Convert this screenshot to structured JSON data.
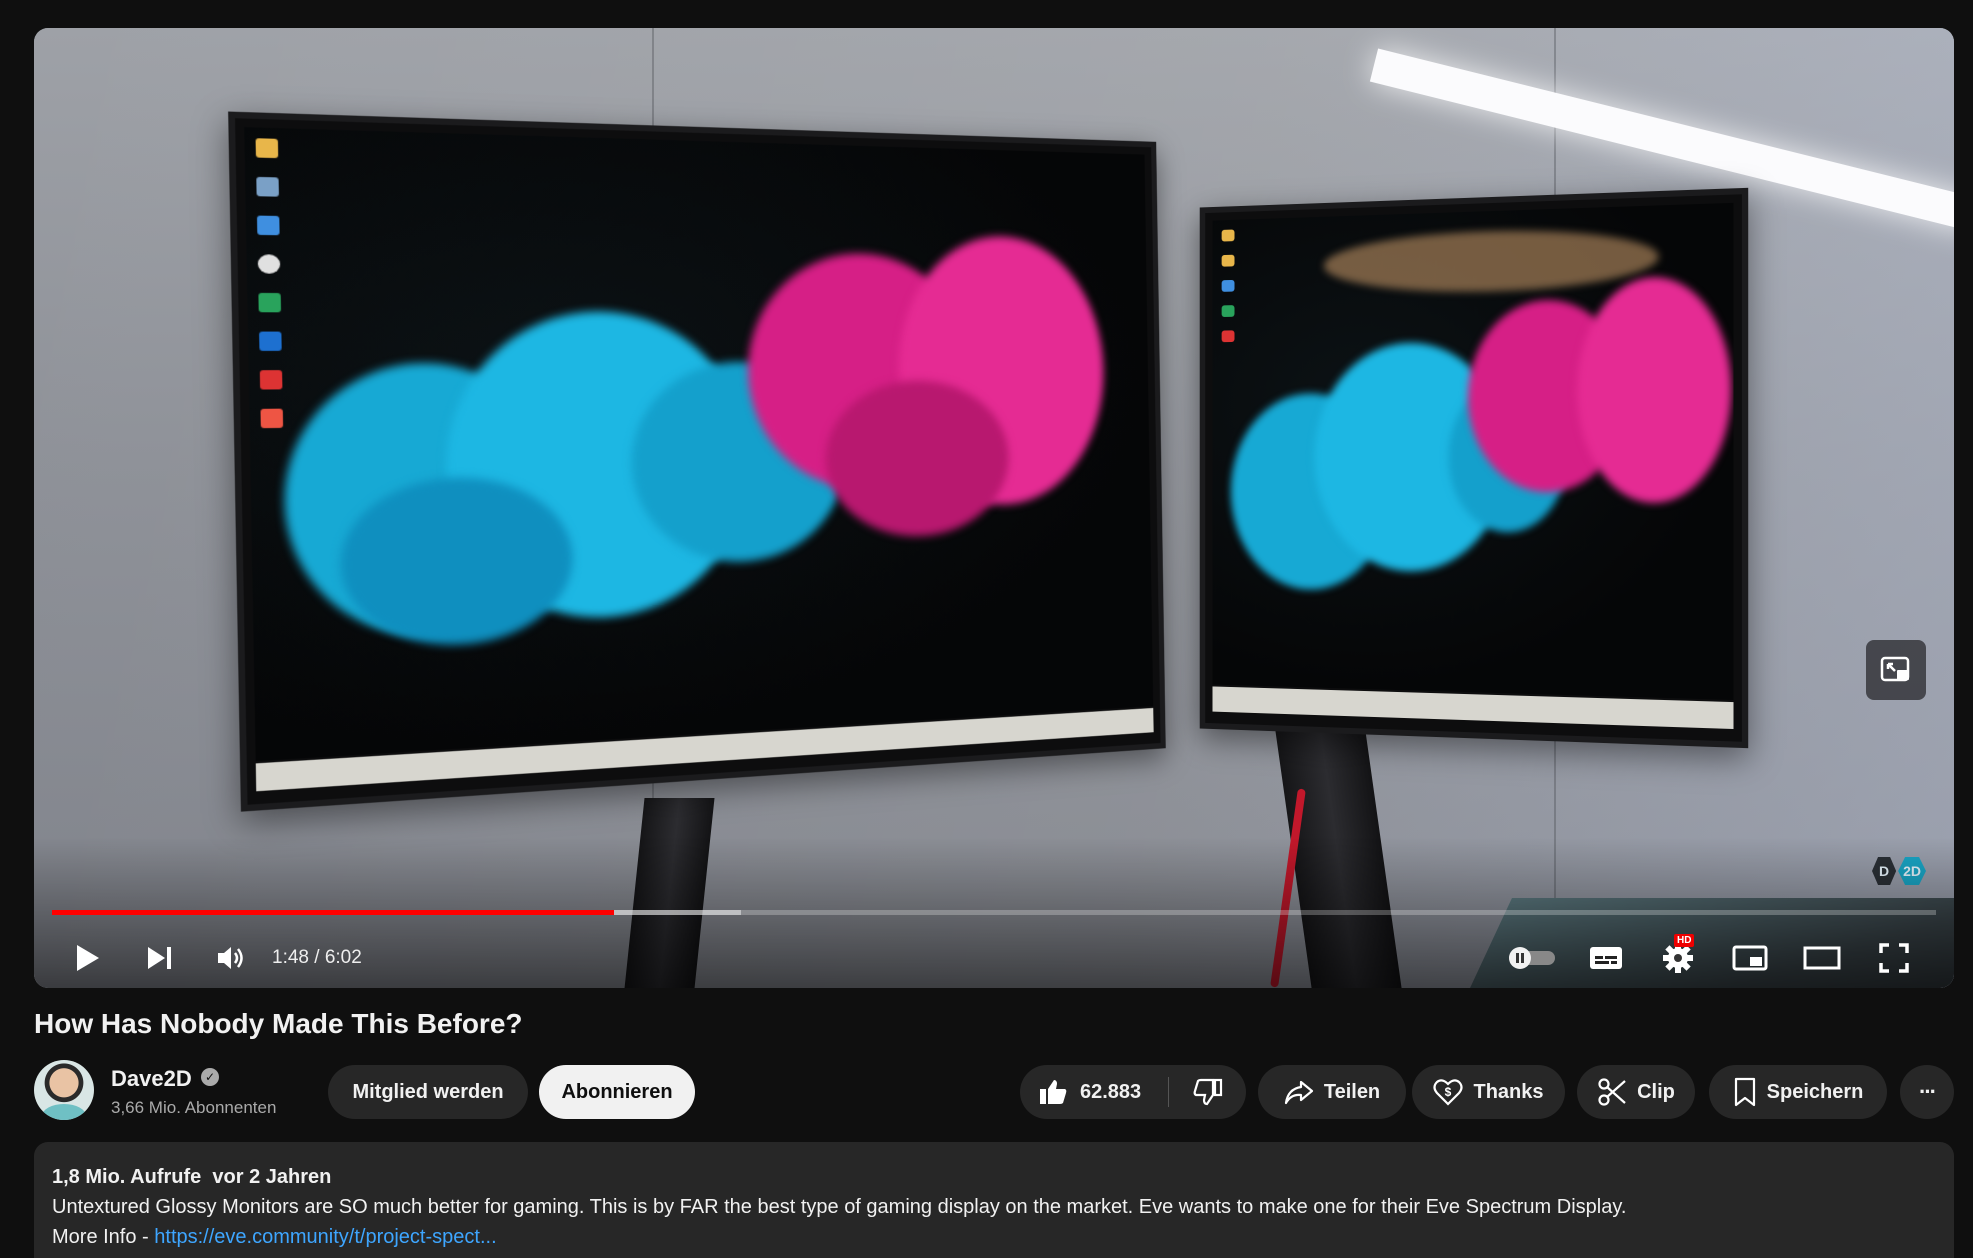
{
  "player": {
    "time_current": "1:48",
    "time_separator": " / ",
    "time_total": "6:02",
    "progress_fraction": 0.2983,
    "buffer_fraction": 0.3655,
    "hd_badge": "HD",
    "watermark": {
      "left": "D",
      "right": "2D"
    },
    "accent_color": "#ff0000",
    "icons": [
      "play-icon",
      "next-icon",
      "volume-icon",
      "autoplay-toggle-icon",
      "subtitles-icon",
      "settings-icon",
      "miniplayer-icon",
      "theater-mode-icon",
      "fullscreen-icon"
    ]
  },
  "video": {
    "title": "How Has Nobody Made This Before?"
  },
  "channel": {
    "name": "Dave2D",
    "verified_mark": "✓",
    "subscribers": "3,66 Mio. Abonnenten"
  },
  "actions": {
    "join_label": "Mitglied werden",
    "subscribe_label": "Abonnieren",
    "like_count": "62.883",
    "share_label": "Teilen",
    "thanks_label": "Thanks",
    "clip_label": "Clip",
    "save_label": "Speichern",
    "more_label": "···"
  },
  "description": {
    "views": "1,8 Mio. Aufrufe",
    "age": "vor 2 Jahren",
    "text": "Untextured Glossy Monitors are SO much better for gaming. This is by FAR the best type of gaming display on the market. Eve wants to make one for their Eve Spectrum Display.",
    "more_info_prefix": "More Info - ",
    "link_text": "https://eve.community/t/project-spect..."
  }
}
